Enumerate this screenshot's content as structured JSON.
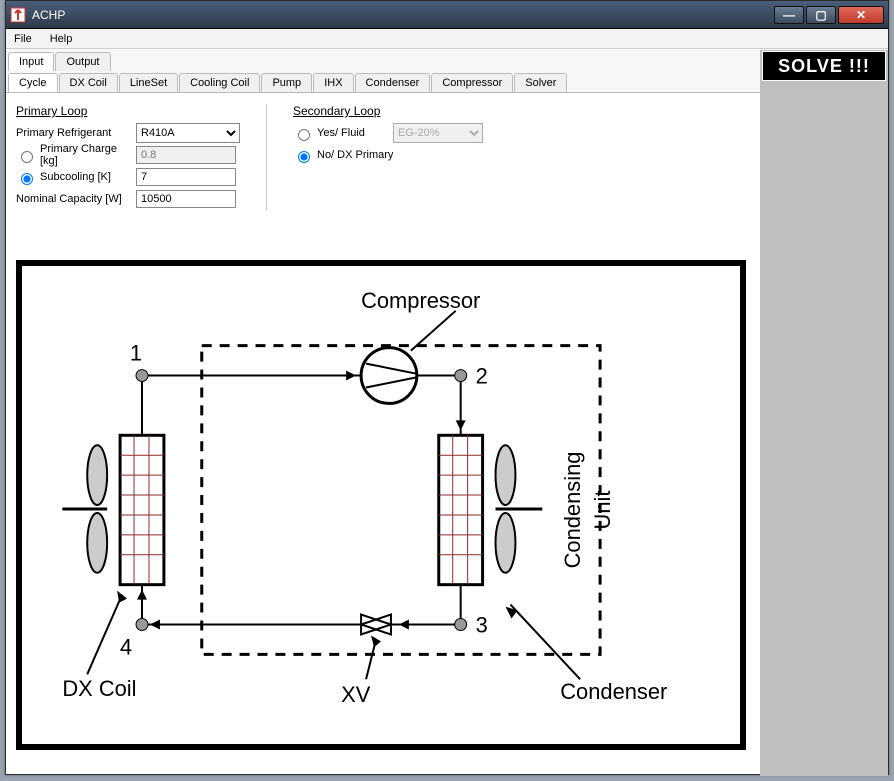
{
  "window": {
    "title": "ACHP"
  },
  "menu": {
    "file": "File",
    "help": "Help"
  },
  "top_tabs": {
    "input": "Input",
    "output": "Output"
  },
  "sub_tabs": {
    "cycle": "Cycle",
    "dxcoil": "DX Coil",
    "lineset": "LineSet",
    "coolingcoil": "Cooling Coil",
    "pump": "Pump",
    "ihx": "IHX",
    "condenser": "Condenser",
    "compressor": "Compressor",
    "solver": "Solver"
  },
  "solve_button": "SOLVE !!!",
  "primary_loop": {
    "header": "Primary Loop",
    "refrigerant_label": "Primary Refrigerant",
    "refrigerant_value": "R410A",
    "charge_label": "Primary Charge [kg]",
    "charge_value": "0.8",
    "subcooling_label": "Subcooling [K]",
    "subcooling_value": "7",
    "capacity_label": "Nominal Capacity [W]",
    "capacity_value": "10500"
  },
  "secondary_loop": {
    "header": "Secondary Loop",
    "yes_label": "Yes/ Fluid",
    "no_label": "No/ DX Primary",
    "fluid_value": "EG-20%"
  },
  "diagram": {
    "compressor": "Compressor",
    "condensing_unit": "Condensing Unit",
    "condenser": "Condenser",
    "dx_coil": "DX Coil",
    "xv": "XV",
    "node1": "1",
    "node2": "2",
    "node3": "3",
    "node4": "4"
  }
}
